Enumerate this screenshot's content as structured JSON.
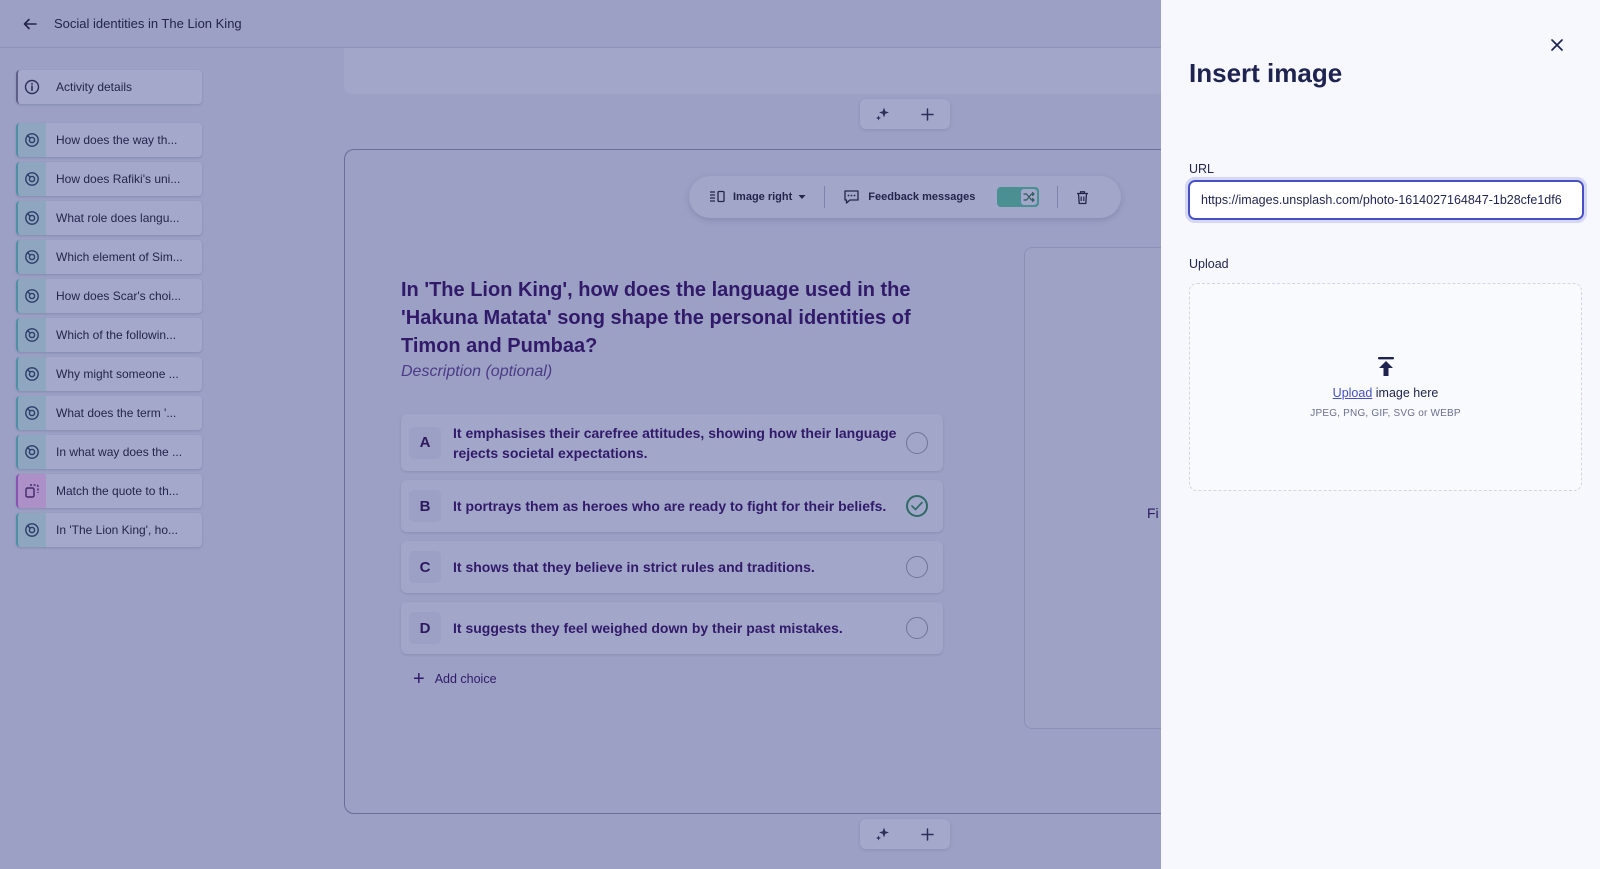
{
  "header": {
    "title": "Social identities in The Lion King"
  },
  "sidebar": {
    "items": [
      {
        "label": "Activity details",
        "icon": "info-icon"
      },
      {
        "label": "How does the way th...",
        "icon": "quiz-icon"
      },
      {
        "label": "How does Rafiki's uni...",
        "icon": "quiz-icon"
      },
      {
        "label": "What role does langu...",
        "icon": "quiz-icon"
      },
      {
        "label": "Which element of Sim...",
        "icon": "quiz-icon"
      },
      {
        "label": "How does Scar's choi...",
        "icon": "quiz-icon"
      },
      {
        "label": "Which of the followin...",
        "icon": "quiz-icon"
      },
      {
        "label": "Why might someone ...",
        "icon": "quiz-icon"
      },
      {
        "label": "What does the term '...",
        "icon": "quiz-icon"
      },
      {
        "label": "In what way does the ...",
        "icon": "quiz-icon"
      },
      {
        "label": "Match the quote to th...",
        "icon": "match-icon"
      },
      {
        "label": "In 'The Lion King', ho...",
        "icon": "quiz-icon"
      }
    ]
  },
  "question": {
    "toolbar": {
      "image_position": "Image right",
      "feedback": "Feedback messages"
    },
    "title": "In 'The Lion King', how does the language used in the 'Hakuna Matata' song shape the personal identities of Timon and Pumbaa?",
    "description_placeholder": "Description (optional)",
    "choices": [
      {
        "letter": "A",
        "text": "It emphasises their carefree attitudes, showing how their language rejects societal expectations.",
        "correct": false
      },
      {
        "letter": "B",
        "text": "It portrays them as heroes who are ready to fight for their beliefs.",
        "correct": true
      },
      {
        "letter": "C",
        "text": "It shows that they believe in strict rules and traditions.",
        "correct": false
      },
      {
        "letter": "D",
        "text": "It suggests they feel weighed down by their past mistakes.",
        "correct": false
      }
    ],
    "add_choice": "Add choice",
    "image_panel_partial_text": "Fi"
  },
  "modal": {
    "title": "Insert image",
    "url_label": "URL",
    "url_value": "https://images.unsplash.com/photo-1614027164847-1b28cfe1df6",
    "upload_label": "Upload",
    "upload_link": "Upload",
    "upload_text": " image here",
    "upload_formats": "JPEG, PNG, GIF, SVG or WEBP"
  },
  "colors": {
    "overlay": "#9ba0c4",
    "accent": "#4650c6",
    "title_text": "#311a69",
    "toggle_on": "#4a8f92"
  }
}
